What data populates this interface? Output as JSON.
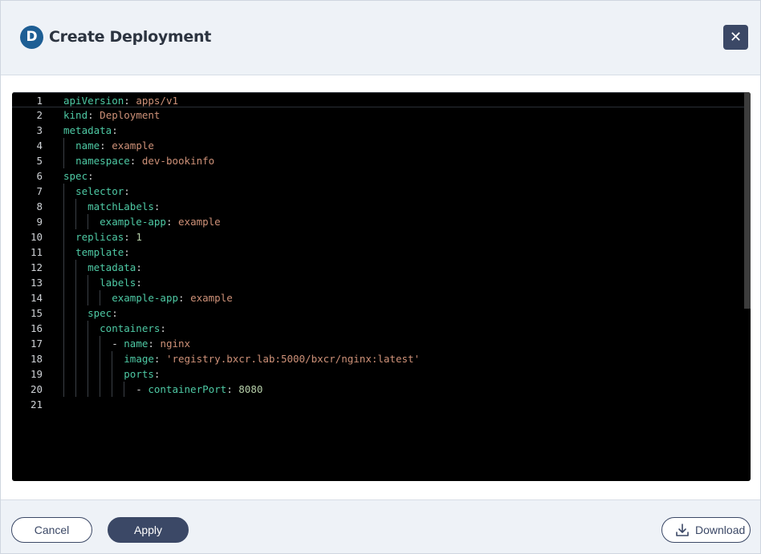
{
  "dialog": {
    "badge_letter": "D",
    "title": "Create Deployment",
    "close_icon": "close-icon"
  },
  "editor": {
    "lines": [
      {
        "num": "1",
        "tokens": [
          {
            "t": "apiVersion",
            "c": "k"
          },
          {
            "t": ": ",
            "c": "p"
          },
          {
            "t": "apps/v1",
            "c": "s"
          }
        ]
      },
      {
        "num": "2",
        "tokens": [
          {
            "t": "kind",
            "c": "k"
          },
          {
            "t": ": ",
            "c": "p"
          },
          {
            "t": "Deployment",
            "c": "s"
          }
        ]
      },
      {
        "num": "3",
        "tokens": [
          {
            "t": "metadata",
            "c": "k"
          },
          {
            "t": ":",
            "c": "p"
          }
        ]
      },
      {
        "num": "4",
        "tokens": [
          {
            "t": "  ",
            "c": "p"
          },
          {
            "t": "name",
            "c": "k"
          },
          {
            "t": ": ",
            "c": "p"
          },
          {
            "t": "example",
            "c": "s"
          }
        ]
      },
      {
        "num": "5",
        "tokens": [
          {
            "t": "  ",
            "c": "p"
          },
          {
            "t": "namespace",
            "c": "k"
          },
          {
            "t": ": ",
            "c": "p"
          },
          {
            "t": "dev-bookinfo",
            "c": "s"
          }
        ]
      },
      {
        "num": "6",
        "tokens": [
          {
            "t": "spec",
            "c": "k"
          },
          {
            "t": ":",
            "c": "p"
          }
        ]
      },
      {
        "num": "7",
        "tokens": [
          {
            "t": "  ",
            "c": "p"
          },
          {
            "t": "selector",
            "c": "k"
          },
          {
            "t": ":",
            "c": "p"
          }
        ]
      },
      {
        "num": "8",
        "tokens": [
          {
            "t": "    ",
            "c": "p"
          },
          {
            "t": "matchLabels",
            "c": "k"
          },
          {
            "t": ":",
            "c": "p"
          }
        ]
      },
      {
        "num": "9",
        "tokens": [
          {
            "t": "      ",
            "c": "p"
          },
          {
            "t": "example-app",
            "c": "k"
          },
          {
            "t": ": ",
            "c": "p"
          },
          {
            "t": "example",
            "c": "s"
          }
        ]
      },
      {
        "num": "10",
        "tokens": [
          {
            "t": "  ",
            "c": "p"
          },
          {
            "t": "replicas",
            "c": "k"
          },
          {
            "t": ": ",
            "c": "p"
          },
          {
            "t": "1",
            "c": "n"
          }
        ]
      },
      {
        "num": "11",
        "tokens": [
          {
            "t": "  ",
            "c": "p"
          },
          {
            "t": "template",
            "c": "k"
          },
          {
            "t": ":",
            "c": "p"
          }
        ]
      },
      {
        "num": "12",
        "tokens": [
          {
            "t": "    ",
            "c": "p"
          },
          {
            "t": "metadata",
            "c": "k"
          },
          {
            "t": ":",
            "c": "p"
          }
        ]
      },
      {
        "num": "13",
        "tokens": [
          {
            "t": "      ",
            "c": "p"
          },
          {
            "t": "labels",
            "c": "k"
          },
          {
            "t": ":",
            "c": "p"
          }
        ]
      },
      {
        "num": "14",
        "tokens": [
          {
            "t": "        ",
            "c": "p"
          },
          {
            "t": "example-app",
            "c": "k"
          },
          {
            "t": ": ",
            "c": "p"
          },
          {
            "t": "example",
            "c": "s"
          }
        ]
      },
      {
        "num": "15",
        "tokens": [
          {
            "t": "    ",
            "c": "p"
          },
          {
            "t": "spec",
            "c": "k"
          },
          {
            "t": ":",
            "c": "p"
          }
        ]
      },
      {
        "num": "16",
        "tokens": [
          {
            "t": "      ",
            "c": "p"
          },
          {
            "t": "containers",
            "c": "k"
          },
          {
            "t": ":",
            "c": "p"
          }
        ]
      },
      {
        "num": "17",
        "tokens": [
          {
            "t": "        - ",
            "c": "p"
          },
          {
            "t": "name",
            "c": "k"
          },
          {
            "t": ": ",
            "c": "p"
          },
          {
            "t": "nginx",
            "c": "s"
          }
        ]
      },
      {
        "num": "18",
        "tokens": [
          {
            "t": "          ",
            "c": "p"
          },
          {
            "t": "image",
            "c": "k"
          },
          {
            "t": ": ",
            "c": "p"
          },
          {
            "t": "'registry.bxcr.lab:5000/bxcr/nginx:latest'",
            "c": "s"
          }
        ]
      },
      {
        "num": "19",
        "tokens": [
          {
            "t": "          ",
            "c": "p"
          },
          {
            "t": "ports",
            "c": "k"
          },
          {
            "t": ":",
            "c": "p"
          }
        ]
      },
      {
        "num": "20",
        "tokens": [
          {
            "t": "            - ",
            "c": "p"
          },
          {
            "t": "containerPort",
            "c": "k"
          },
          {
            "t": ": ",
            "c": "p"
          },
          {
            "t": "8080",
            "c": "n"
          }
        ]
      },
      {
        "num": "21",
        "tokens": []
      }
    ]
  },
  "footer": {
    "cancel_label": "Cancel",
    "apply_label": "Apply",
    "download_label": "Download",
    "download_icon": "download-icon"
  },
  "colors": {
    "key": "#4ec9a4",
    "string": "#ce9178",
    "number": "#b5cea8",
    "primary": "#3b4866",
    "badge": "#1d5e94"
  }
}
